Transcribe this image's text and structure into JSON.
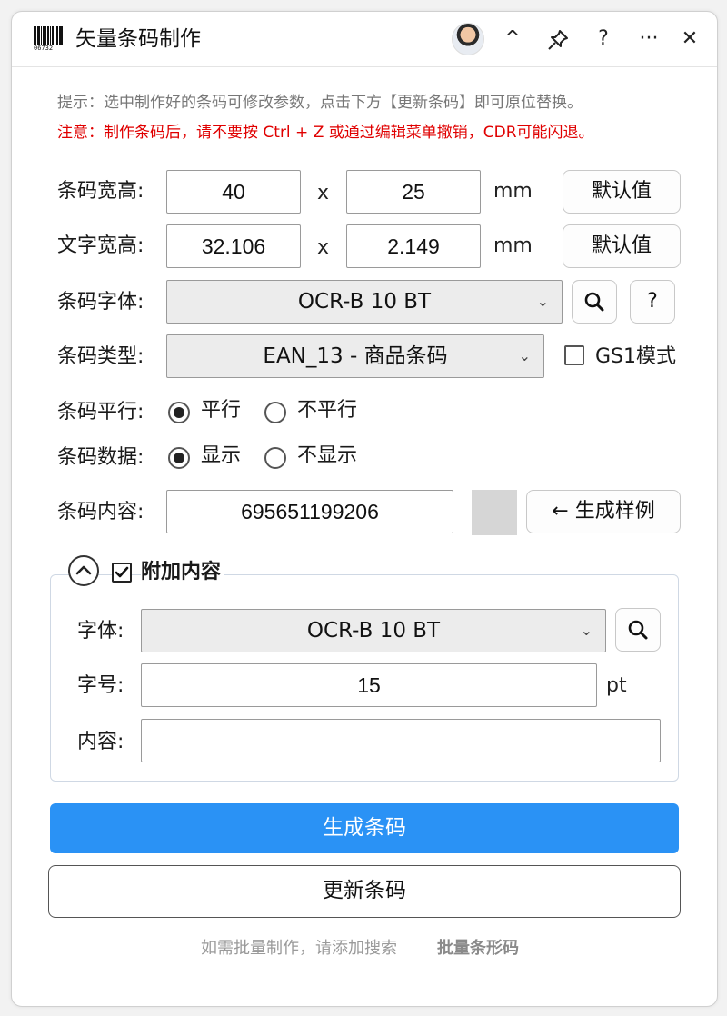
{
  "app": {
    "title": "矢量条码制作",
    "logo_number": "06732"
  },
  "titlebar": {
    "collapse_symbol": "^",
    "help_symbol": "?",
    "more_symbol": "···",
    "close_symbol": "✕"
  },
  "hints": {
    "tip": "提示：选中制作好的条码可修改参数，点击下方【更新条码】即可原位替换。",
    "warning": "注意：制作条码后，请不要按 Ctrl + Z 或通过编辑菜单撤销，CDR可能闪退。"
  },
  "barcode_size": {
    "label": "条码宽高:",
    "width": "40",
    "separator": "x",
    "height": "25",
    "unit": "mm",
    "default_button": "默认值"
  },
  "text_size": {
    "label": "文字宽高:",
    "width": "32.106",
    "separator": "x",
    "height": "2.149",
    "unit": "mm",
    "default_button": "默认值"
  },
  "barcode_font": {
    "label": "条码字体:",
    "selected": "OCR-B 10 BT",
    "help_button": "?"
  },
  "barcode_type": {
    "label": "条码类型:",
    "selected": "EAN_13 - 商品条码",
    "gs1_label": "GS1模式",
    "gs1_checked": false
  },
  "barcode_parallel": {
    "label": "条码平行:",
    "options": [
      "平行",
      "不平行"
    ],
    "selected": "平行"
  },
  "barcode_data": {
    "label": "条码数据:",
    "options": [
      "显示",
      "不显示"
    ],
    "selected": "显示"
  },
  "barcode_content": {
    "label": "条码内容:",
    "value": "695651199206",
    "sample_button": "← 生成样例"
  },
  "extra": {
    "title": "附加内容",
    "checked": true,
    "font_label": "字体:",
    "font_selected": "OCR-B 10 BT",
    "size_label": "字号:",
    "size_value": "15",
    "size_unit": "pt",
    "content_label": "内容:",
    "content_value": ""
  },
  "actions": {
    "generate": "生成条码",
    "update": "更新条码"
  },
  "footer": {
    "text": "如需批量制作，请添加搜索",
    "highlight": "批量条形码"
  },
  "colors": {
    "primary": "#2a92f5",
    "warning": "#e00000"
  }
}
